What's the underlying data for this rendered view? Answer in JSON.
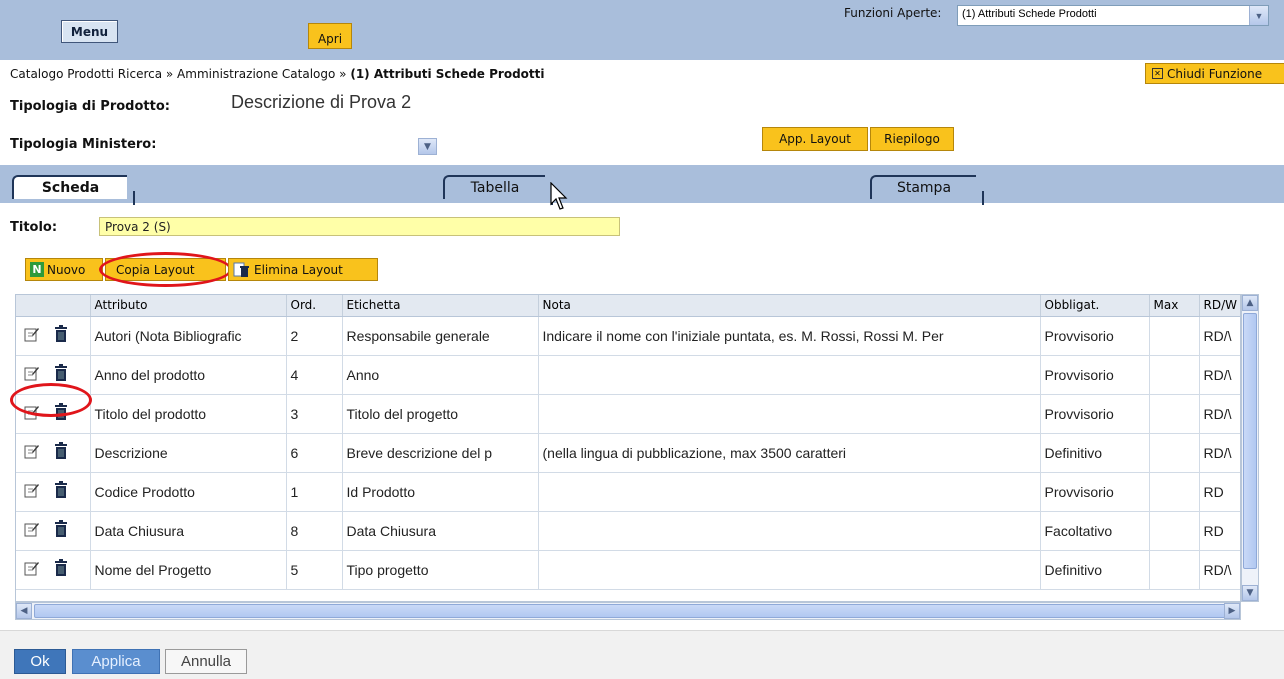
{
  "topbar": {
    "menu_label": "Menu",
    "apri_label": "Apri",
    "funzioni_label": "Funzioni Aperte:",
    "funzioni_value": "(1) Attributi Schede Prodotti"
  },
  "breadcrumb": {
    "path": "Catalogo Prodotti Ricerca » Amministrazione Catalogo » ",
    "current": "(1) Attributi Schede Prodotti"
  },
  "chiudi_label": "Chiudi Funzione",
  "tipologia_prodotto": {
    "label": "Tipologia di Prodotto:",
    "value": "Descrizione di Prova 2"
  },
  "tipologia_ministero": {
    "label": "Tipologia Ministero:"
  },
  "buttons": {
    "app_layout": "App. Layout",
    "riepilogo": "Riepilogo"
  },
  "tabs": [
    {
      "label": "Scheda",
      "active": true
    },
    {
      "label": "Tabella",
      "active": false
    },
    {
      "label": "Stampa",
      "active": false
    }
  ],
  "titolo": {
    "label": "Titolo:",
    "value": "Prova 2 (S)"
  },
  "toolbar": {
    "nuovo": "Nuovo",
    "copia_layout": "Copia Layout",
    "elimina_layout": "Elimina Layout"
  },
  "table": {
    "columns": [
      "",
      "Attributo",
      "Ord.",
      "Etichetta",
      "Nota",
      "Obbligat.",
      "Max",
      "RD/W"
    ],
    "rows": [
      {
        "attributo": "Autori (Nota Bibliografic",
        "ord": "2",
        "etichetta": "Responsabile generale",
        "nota": "Indicare il nome con l'iniziale puntata, es. M. Rossi, Rossi M. Per",
        "obbligat": "Provvisorio",
        "max": "",
        "rdw": "RD/\\"
      },
      {
        "attributo": "Anno del prodotto",
        "ord": "4",
        "etichetta": "Anno",
        "nota": "",
        "obbligat": "Provvisorio",
        "max": "",
        "rdw": "RD/\\"
      },
      {
        "attributo": "Titolo del prodotto",
        "ord": "3",
        "etichetta": "Titolo del progetto",
        "nota": "",
        "obbligat": "Provvisorio",
        "max": "",
        "rdw": "RD/\\"
      },
      {
        "attributo": "Descrizione",
        "ord": "6",
        "etichetta": "Breve descrizione del p",
        "nota": "(nella lingua di pubblicazione, max 3500 caratteri",
        "obbligat": "Definitivo",
        "max": "",
        "rdw": "RD/\\"
      },
      {
        "attributo": "Codice Prodotto",
        "ord": "1",
        "etichetta": "Id Prodotto",
        "nota": "",
        "obbligat": "Provvisorio",
        "max": "",
        "rdw": "RD"
      },
      {
        "attributo": "Data Chiusura",
        "ord": "8",
        "etichetta": "Data Chiusura",
        "nota": "",
        "obbligat": "Facoltativo",
        "max": "",
        "rdw": "RD"
      },
      {
        "attributo": "Nome del Progetto",
        "ord": "5",
        "etichetta": "Tipo progetto",
        "nota": "",
        "obbligat": "Definitivo",
        "max": "",
        "rdw": "RD/\\"
      }
    ]
  },
  "footer": {
    "ok": "Ok",
    "applica": "Applica",
    "annulla": "Annulla"
  },
  "colors": {
    "bar_blue": "#a9bedb",
    "button_yellow": "#f9c21c",
    "title_input": "#ffffa8",
    "highlight_red": "#e0151b",
    "footer_blue": "#3f76ba"
  }
}
